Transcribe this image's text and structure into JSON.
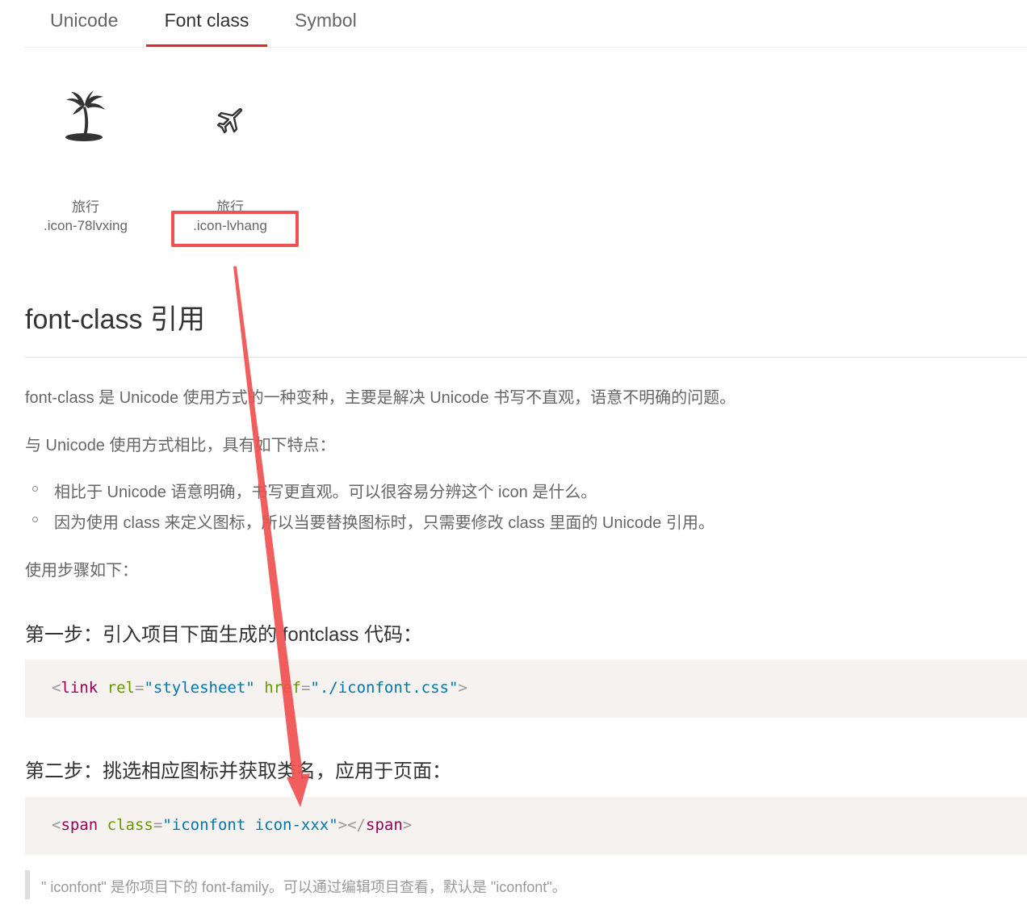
{
  "tabs": {
    "unicode": "Unicode",
    "font_class": "Font class",
    "symbol": "Symbol",
    "active": "Font class",
    "active_color": "#e4262c"
  },
  "icons": [
    {
      "icon": "palm-tree-island-icon",
      "name": "旅行",
      "code": ".icon-78lvxing"
    },
    {
      "icon": "airplane-icon",
      "name": "旅行",
      "code": ".icon-lvhang"
    }
  ],
  "section": {
    "title": "font-class 引用",
    "intro": "font-class 是 Unicode 使用方式的一种变种，主要是解决 Unicode 书写不直观，语意不明确的问题。",
    "compare": "与 Unicode 使用方式相比，具有如下特点：",
    "features": [
      "相比于 Unicode 语意明确，书写更直观。可以很容易分辨这个 icon 是什么。",
      "因为使用 class 来定义图标，所以当要替换图标时，只需要修改 class 里面的 Unicode 引用。"
    ],
    "steps_intro": "使用步骤如下：",
    "step1": "第一步：引入项目下面生成的 fontclass 代码：",
    "step2": "第二步：挑选相应图标并获取类名，应用于页面：",
    "note": "\" iconfont\" 是你项目下的 font-family。可以通过编辑项目查看，默认是 \"iconfont\"。"
  },
  "code1": {
    "open": "<",
    "tag": "link",
    "attr1": "rel",
    "eq": "=",
    "val1": "\"stylesheet\"",
    "attr2": "href",
    "val2": "\"./iconfont.css\"",
    "close": ">"
  },
  "code2": {
    "open": "<",
    "tag": "span",
    "attr1": "class",
    "eq": "=",
    "val1": "\"iconfont icon-xxx\"",
    "mid": "></",
    "tag2": "span",
    "close": ">"
  },
  "annotation": {
    "highlight_color": "#f05050",
    "arrow_color": "#f05050"
  }
}
